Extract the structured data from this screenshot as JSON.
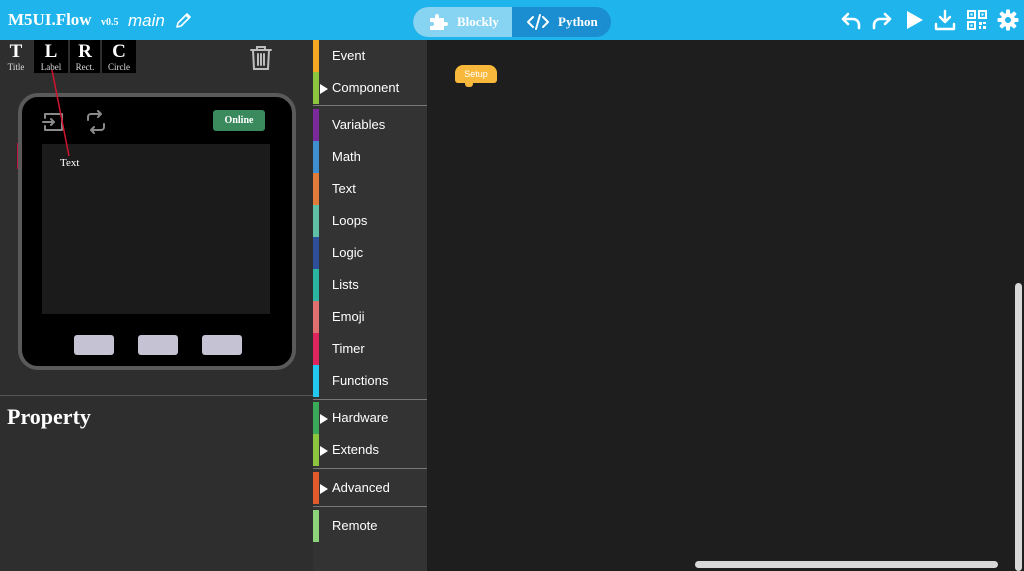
{
  "header": {
    "brand": "M5UI.Flow",
    "version": "v0.5",
    "file_name": "main",
    "toggle": {
      "blockly": "Blockly",
      "python": "Python",
      "active": "Blockly"
    },
    "icons": [
      "undo-icon",
      "redo-icon",
      "run-icon",
      "download-icon",
      "qr-code-icon",
      "settings-icon"
    ]
  },
  "tools": [
    {
      "big": "T",
      "small": "Title"
    },
    {
      "big": "L",
      "small": "Label"
    },
    {
      "big": "R",
      "small": "Rect."
    },
    {
      "big": "C",
      "small": "Circle"
    }
  ],
  "device": {
    "status": "Online",
    "screen_label": "Text"
  },
  "property": {
    "title": "Property"
  },
  "categories": [
    {
      "label": "Event",
      "color": "#f5a623",
      "arrow": false
    },
    {
      "label": "Component",
      "color": "#8cc63f",
      "arrow": true
    },
    {
      "label": "Variables",
      "color": "#7a2a9a",
      "arrow": false
    },
    {
      "label": "Math",
      "color": "#3d8fd1",
      "arrow": false
    },
    {
      "label": "Text",
      "color": "#e07b39",
      "arrow": false
    },
    {
      "label": "Loops",
      "color": "#5fbfa6",
      "arrow": false
    },
    {
      "label": "Logic",
      "color": "#2f4f9a",
      "arrow": false
    },
    {
      "label": "Lists",
      "color": "#2ab5a0",
      "arrow": false
    },
    {
      "label": "Emoji",
      "color": "#e07070",
      "arrow": false
    },
    {
      "label": "Timer",
      "color": "#e0245e",
      "arrow": false
    },
    {
      "label": "Functions",
      "color": "#22c7f0",
      "arrow": false
    },
    {
      "label": "Hardware",
      "color": "#3aaa5a",
      "arrow": true
    },
    {
      "label": "Extends",
      "color": "#8cc63f",
      "arrow": true
    },
    {
      "label": "Advanced",
      "color": "#e25a2a",
      "arrow": true
    },
    {
      "label": "Remote",
      "color": "#8dd37a",
      "arrow": false
    }
  ],
  "workspace": {
    "setup_block": "Setup"
  }
}
